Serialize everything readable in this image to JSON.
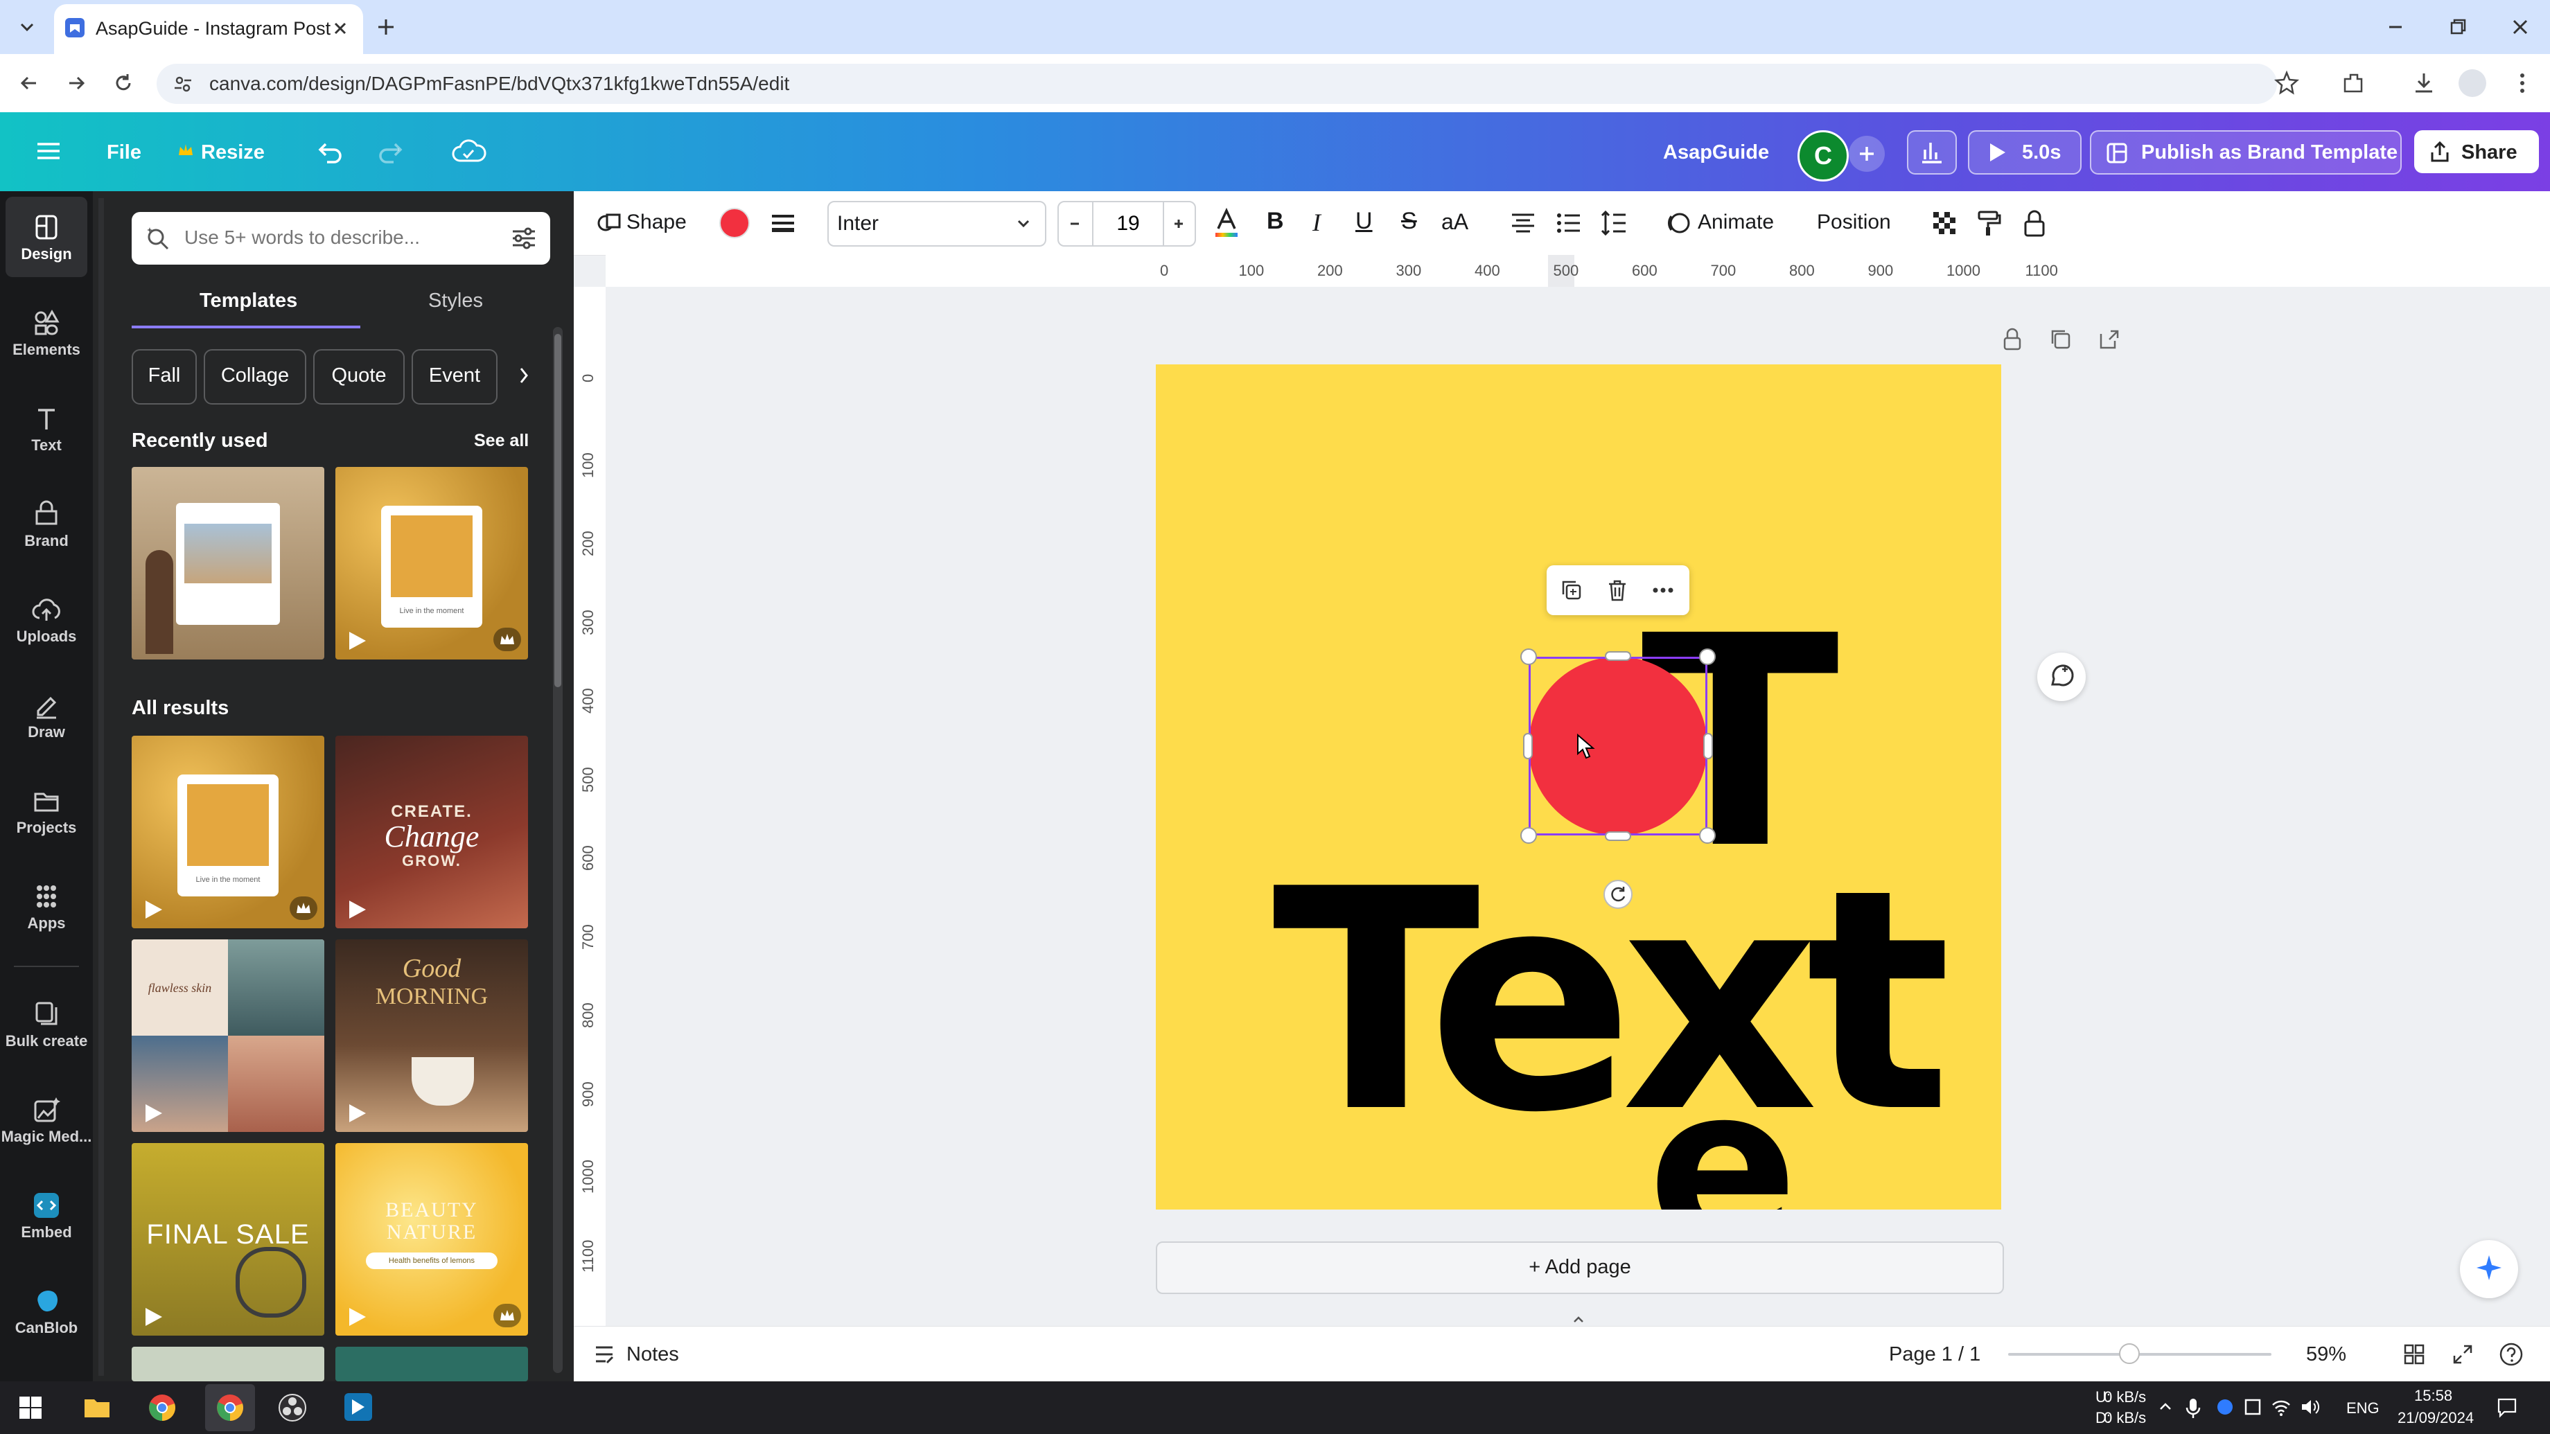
{
  "browser": {
    "tab_title": "AsapGuide - Instagram Post",
    "url": "canva.com/design/DAGPmFasnPE/bdVQtx371kfg1kweTdn55A/edit"
  },
  "header": {
    "file": "File",
    "resize": "Resize",
    "team": "AsapGuide",
    "avatar_letter": "C",
    "play_time": "5.0s",
    "publish": "Publish as Brand Template",
    "share": "Share"
  },
  "rail": {
    "items": [
      {
        "label": "Design",
        "icon": "design-icon"
      },
      {
        "label": "Elements",
        "icon": "elements-icon"
      },
      {
        "label": "Text",
        "icon": "text-icon"
      },
      {
        "label": "Brand",
        "icon": "brand-icon"
      },
      {
        "label": "Uploads",
        "icon": "uploads-icon"
      },
      {
        "label": "Draw",
        "icon": "draw-icon"
      },
      {
        "label": "Projects",
        "icon": "projects-icon"
      },
      {
        "label": "Apps",
        "icon": "apps-icon"
      },
      {
        "label": "Bulk create",
        "icon": "bulk-create-icon"
      },
      {
        "label": "Magic Med...",
        "icon": "magic-media-icon"
      },
      {
        "label": "Embed",
        "icon": "embed-icon"
      },
      {
        "label": "CanBlob",
        "icon": "canblob-icon"
      }
    ]
  },
  "panel": {
    "search_placeholder": "Use 5+ words to describe...",
    "tabs": [
      "Templates",
      "Styles"
    ],
    "chips": [
      "Fall",
      "Collage",
      "Quote",
      "Event"
    ],
    "recently_used": "Recently used",
    "see_all": "See all",
    "all_results": "All results",
    "thumb_texts": {
      "live": "Live in the moment",
      "create": "CREATE.",
      "change": "Change",
      "grow": "GROW.",
      "flawless": "flawless skin",
      "good": "Good",
      "morning": "MORNING",
      "final_sale": "FINAL SALE",
      "beauty": "BEAUTY",
      "nature": "NATURE",
      "health": "Health benefits of lemons"
    }
  },
  "toolbar": {
    "shape": "Shape",
    "font": "Inter",
    "font_size": "19",
    "animate": "Animate",
    "position": "Position",
    "shape_color": "#f2303f"
  },
  "rulers": {
    "h": [
      "0",
      "100",
      "200",
      "300",
      "400",
      "500",
      "600",
      "700",
      "800",
      "900",
      "1000",
      "1100"
    ],
    "v": [
      "0",
      "100",
      "200",
      "300",
      "400",
      "500",
      "600",
      "700",
      "800",
      "900",
      "1000",
      "1100"
    ]
  },
  "canvas": {
    "background": "#fedc4b",
    "big_text": "Text",
    "letter_t": "T",
    "letter_e": "e",
    "add_page": "+ Add page"
  },
  "footer": {
    "notes": "Notes",
    "page": "Page 1 / 1",
    "zoom": "59%",
    "zoom_level": 0.46
  },
  "taskbar": {
    "net_up": "0 kB/s",
    "net_down": "0 kB/s",
    "u": "U:",
    "d": "D:",
    "lang": "ENG",
    "time": "15:58",
    "date": "21/09/2024"
  }
}
